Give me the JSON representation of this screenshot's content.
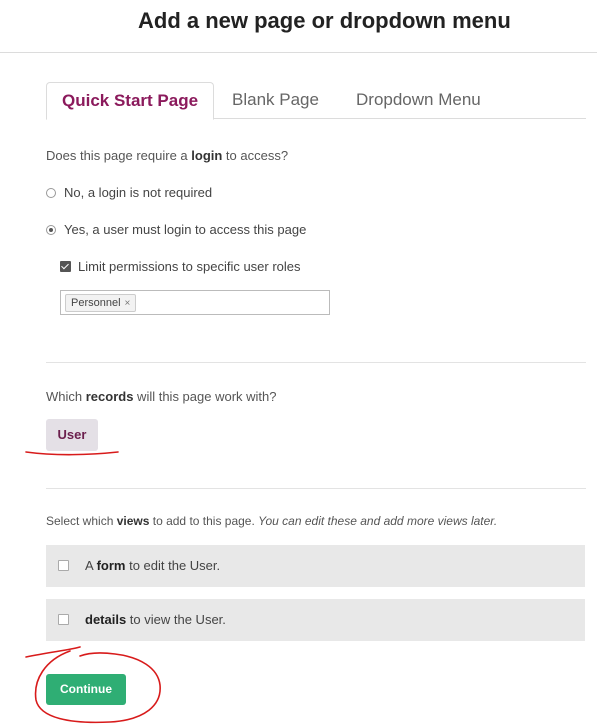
{
  "header": {
    "title": "Add a new page or dropdown menu"
  },
  "tabs": [
    {
      "label": "Quick Start Page",
      "active": true
    },
    {
      "label": "Blank Page",
      "active": false
    },
    {
      "label": "Dropdown Menu",
      "active": false
    }
  ],
  "login": {
    "question_prefix": "Does this page require a ",
    "question_bold": "login",
    "question_suffix": " to access?",
    "options": [
      {
        "label": "No, a login is not required",
        "selected": false
      },
      {
        "label": "Yes, a user must login to access this page",
        "selected": true
      }
    ],
    "limit_label": "Limit permissions to specific user roles",
    "limit_checked": true,
    "roles": [
      "Personnel"
    ],
    "remove_glyph": "×"
  },
  "records": {
    "question_prefix": "Which ",
    "question_bold": "records",
    "question_suffix": " will this page work with?",
    "selected_label": "User"
  },
  "views": {
    "question_prefix": "Select which ",
    "question_bold": "views",
    "question_mid": " to add to this page. ",
    "question_italic": "You can edit these and add more views later.",
    "items": [
      {
        "prefix": "A ",
        "bold": "form",
        "suffix": " to edit the User.",
        "checked": false
      },
      {
        "prefix": "",
        "bold": "details",
        "suffix": " to view the User.",
        "checked": false
      }
    ]
  },
  "continue_label": "Continue",
  "annotation_color": "#d81b1b"
}
